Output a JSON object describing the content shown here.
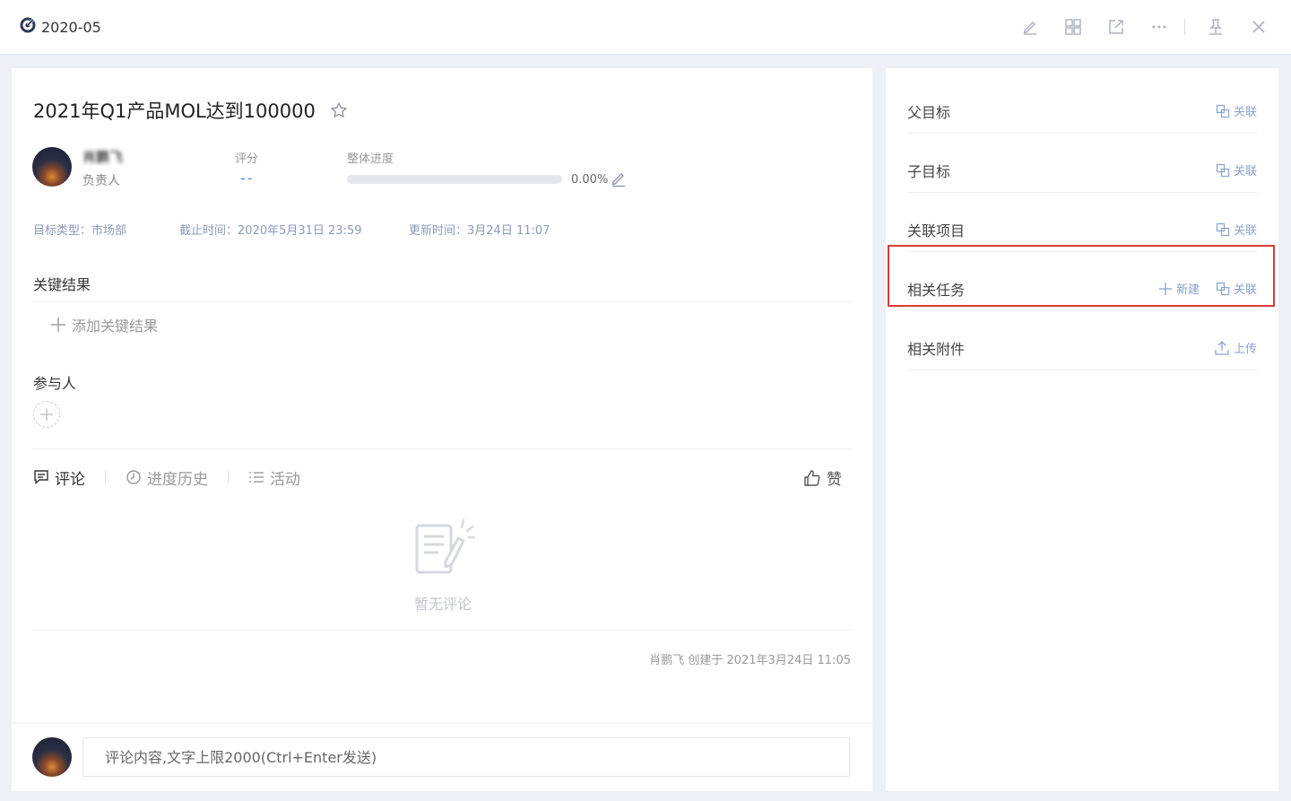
{
  "window": {
    "title": "2020-05"
  },
  "goal": {
    "title": "2021年Q1产品MOL达到100000",
    "owner_name": "肖鹏飞",
    "owner_role": "负责人",
    "score_label": "评分",
    "score_value": "--",
    "progress_label": "整体进度",
    "progress_fraction": 0.0,
    "progress_text": "0.00%",
    "type_text": "目标类型：市场部",
    "deadline_text": "截止时间：2020年5月31日 23:59",
    "updated_text": "更新时间：3月24日 11:07"
  },
  "key_results": {
    "title": "关键结果",
    "add_label": "添加关键结果"
  },
  "participants": {
    "title": "参与人"
  },
  "tabs": [
    {
      "label": "评论",
      "icon": "comment-icon"
    },
    {
      "label": "进度历史",
      "icon": "history-icon"
    },
    {
      "label": "活动",
      "icon": "list-icon"
    }
  ],
  "like": {
    "label": "赞",
    "icon": "thumb-up-icon"
  },
  "comments": {
    "empty_text": "暂无评论",
    "creator_text": "肖鹏飞 创建于 2021年3月24日 11:05",
    "input_placeholder": "评论内容,文字上限2000(Ctrl+Enter发送)"
  },
  "relations": [
    {
      "title": "父目标",
      "actions": [
        {
          "label": "关联",
          "icon": "link-icon"
        }
      ]
    },
    {
      "title": "子目标",
      "actions": [
        {
          "label": "关联",
          "icon": "link-icon"
        }
      ]
    },
    {
      "title": "关联项目",
      "actions": [
        {
          "label": "关联",
          "icon": "link-icon"
        }
      ]
    },
    {
      "title": "相关任务",
      "actions": [
        {
          "label": "新建",
          "icon": "plus-icon"
        },
        {
          "label": "关联",
          "icon": "link-icon"
        }
      ]
    },
    {
      "title": "相关附件",
      "actions": [
        {
          "label": "上传",
          "icon": "upload-icon"
        }
      ]
    }
  ],
  "colors": {
    "accent": "#3b82f6",
    "link": "#8aa2cc",
    "highlight": "#d93a3a",
    "background": "#eef0f7"
  }
}
